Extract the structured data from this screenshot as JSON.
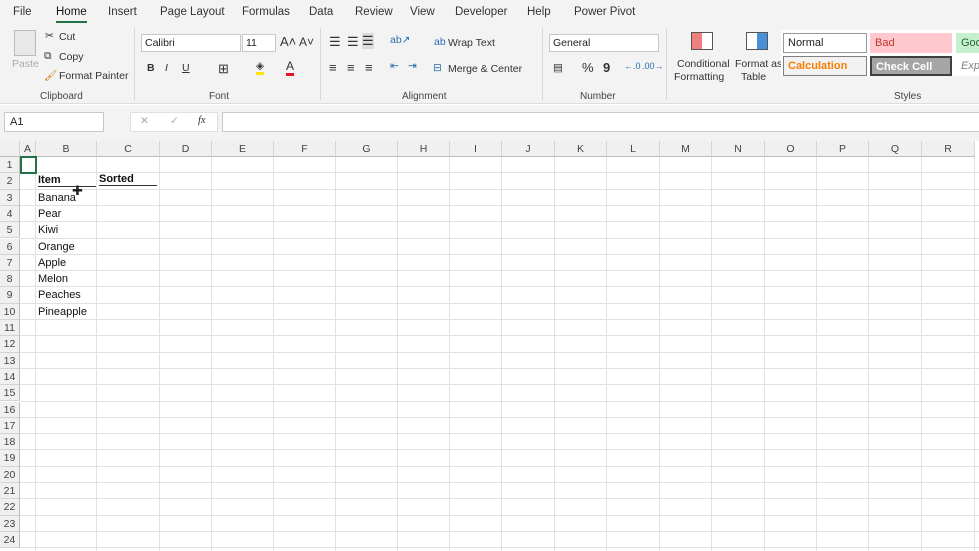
{
  "menu": {
    "tabs": [
      "File",
      "Home",
      "Insert",
      "Page Layout",
      "Formulas",
      "Data",
      "Review",
      "View",
      "Developer",
      "Help",
      "Power Pivot"
    ],
    "active": "Home"
  },
  "ribbon": {
    "clipboard": {
      "label": "Clipboard",
      "paste": "Paste",
      "cut": "Cut",
      "copy": "Copy",
      "format_painter": "Format Painter"
    },
    "font": {
      "label": "Font",
      "name": "Calibri",
      "size": "11",
      "bold": "B",
      "italic": "I",
      "underline": "U",
      "font_color": "#e81123",
      "highlight_color": "#ffe600"
    },
    "alignment": {
      "label": "Alignment",
      "wrap_text": "Wrap Text",
      "merge_center": "Merge & Center"
    },
    "number": {
      "label": "Number",
      "format": "General",
      "percent": "%",
      "comma": "9"
    },
    "styles": {
      "label": "Styles",
      "conditional_formatting": [
        "Conditional",
        "Formatting"
      ],
      "format_as_table": [
        "Format as",
        "Table"
      ],
      "cells": [
        {
          "name": "Normal"
        },
        {
          "name": "Bad"
        },
        {
          "name": "Goo"
        },
        {
          "name": "Calculation"
        },
        {
          "name": "Check Cell"
        },
        {
          "name": "Exp"
        }
      ]
    }
  },
  "formula_bar": {
    "name_box": "A1",
    "fx": "fx",
    "value": ""
  },
  "sheet": {
    "columns": [
      "A",
      "B",
      "C",
      "D",
      "E",
      "F",
      "G",
      "H",
      "I",
      "J",
      "K",
      "L",
      "M",
      "N",
      "O",
      "P",
      "Q",
      "R"
    ],
    "rows": [
      "1",
      "2",
      "3",
      "4",
      "5",
      "6",
      "7",
      "8",
      "9",
      "10",
      "11",
      "12",
      "13",
      "14",
      "15",
      "16",
      "17",
      "18",
      "19",
      "20",
      "21",
      "22",
      "23",
      "24"
    ],
    "headers": {
      "B2": "Item",
      "C2": "Sorted"
    },
    "items": [
      "Banana",
      "Pear",
      "Kiwi",
      "Orange",
      "Apple",
      "Melon",
      "Peaches",
      "Pineapple"
    ],
    "selected_cell": "A1"
  }
}
